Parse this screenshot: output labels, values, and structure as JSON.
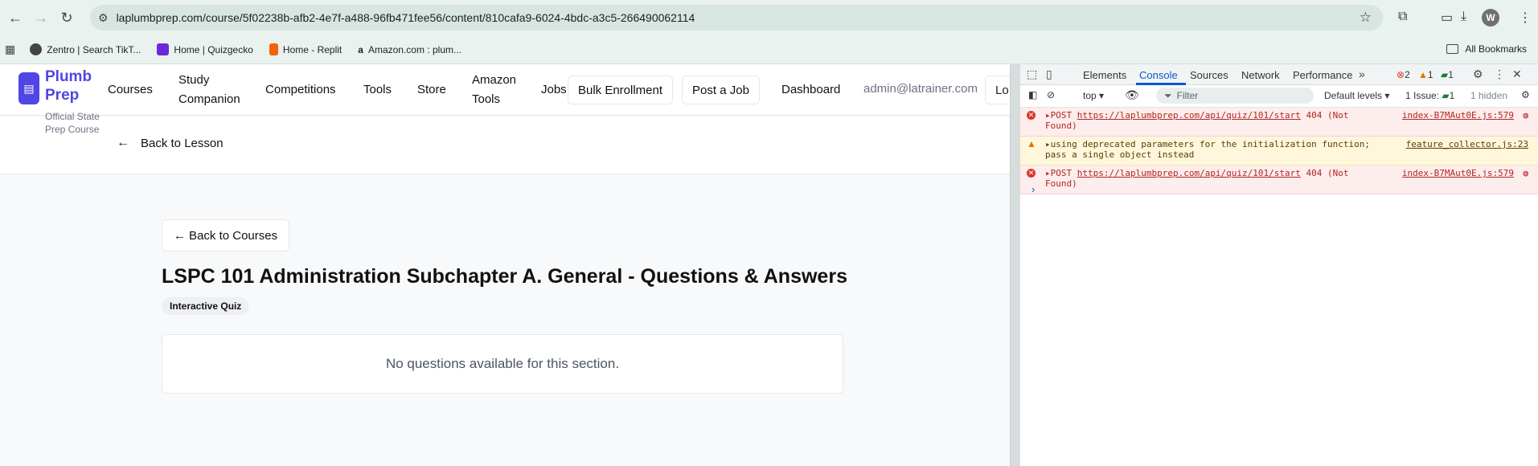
{
  "browser": {
    "url": "laplumbprep.com/course/5f02238b-afb2-4e7f-a488-96fb471fee56/content/810cafa9-6024-4bdc-a3c5-266490062114",
    "avatar_letter": "W",
    "bookmarks": [
      {
        "label": "Zentro | Search TikT...",
        "color": "#333333"
      },
      {
        "label": "Home | Quizgecko",
        "color": "#6d28d9"
      },
      {
        "label": "Home - Replit",
        "color": "#f26207"
      },
      {
        "label": "Amazon.com : plum...",
        "color": "#222222"
      }
    ],
    "all_bookmarks": "All Bookmarks"
  },
  "site": {
    "brand_line1": "Plumb",
    "brand_line2": "Prep",
    "tagline_line1": "Official State",
    "tagline_line2": "Prep Course",
    "nav": {
      "courses": "Courses",
      "study_1": "Study",
      "study_2": "Companion",
      "competitions": "Competitions",
      "tools": "Tools",
      "store": "Store",
      "amazon_1": "Amazon",
      "amazon_2": "Tools",
      "jobs": "Jobs",
      "bulk": "Bulk Enrollment",
      "post_job": "Post a Job",
      "dashboard": "Dashboard",
      "email": "admin@latrainer.com",
      "lo": "Lo"
    },
    "back_to_lesson": "Back to Lesson",
    "back_to_courses": "← Back to Courses",
    "title": "LSPC 101 Administration Subchapter A. General - Questions & Answers",
    "badge": "Interactive Quiz",
    "empty": "No questions available for this section."
  },
  "devtools": {
    "tabs": {
      "elements": "Elements",
      "console": "Console",
      "sources": "Sources",
      "network": "Network",
      "performance": "Performance"
    },
    "counts": {
      "errors": "2",
      "warnings": "1",
      "messages": "1"
    },
    "context": "top",
    "filter_placeholder": "Filter",
    "levels": "Default levels",
    "issues_label": "1 Issue:",
    "issues_count": "1",
    "hidden": "1 hidden",
    "logs": [
      {
        "type": "error",
        "method": "POST",
        "url": "https://laplumbprep.com/api/quiz/101/start",
        "status": "404 (Not",
        "status2": "Found)",
        "source": "index-B7MAut0E.js:579"
      },
      {
        "type": "warning",
        "text1": "using deprecated parameters for the initialization function;",
        "text2": "pass a single object instead",
        "source": "feature_collector.js:23"
      },
      {
        "type": "error",
        "method": "POST",
        "url": "https://laplumbprep.com/api/quiz/101/start",
        "status": "404 (Not",
        "status2": "Found)",
        "source": "index-B7MAut0E.js:579"
      }
    ]
  }
}
